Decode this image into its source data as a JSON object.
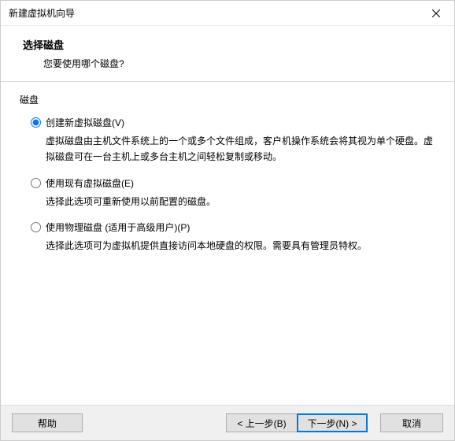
{
  "window": {
    "title": "新建虚拟机向导"
  },
  "header": {
    "title": "选择磁盘",
    "subtitle": "您要使用哪个磁盘?"
  },
  "group": {
    "label": "磁盘"
  },
  "options": [
    {
      "label": "创建新虚拟磁盘(V)",
      "desc": "虚拟磁盘由主机文件系统上的一个或多个文件组成，客户机操作系统会将其视为单个硬盘。虚拟磁盘可在一台主机上或多台主机之间轻松复制或移动。",
      "checked": true
    },
    {
      "label": "使用现有虚拟磁盘(E)",
      "desc": "选择此选项可重新使用以前配置的磁盘。",
      "checked": false
    },
    {
      "label": "使用物理磁盘 (适用于高级用户)(P)",
      "desc": "选择此选项可为虚拟机提供直接访问本地硬盘的权限。需要具有管理员特权。",
      "checked": false
    }
  ],
  "buttons": {
    "help": "帮助",
    "back": "< 上一步(B)",
    "next": "下一步(N) >",
    "cancel": "取消"
  }
}
